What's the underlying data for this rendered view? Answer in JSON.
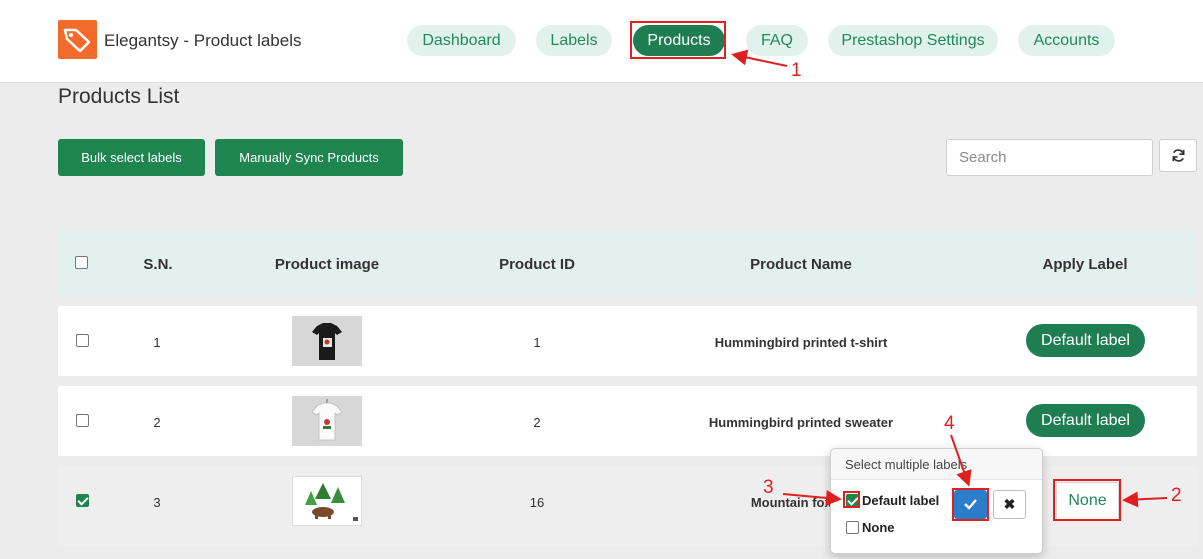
{
  "header": {
    "app_title": "Elegantsy - Product labels",
    "logo_icon": "price-tag-icon",
    "nav": [
      {
        "label": "Dashboard",
        "active": false
      },
      {
        "label": "Labels",
        "active": false
      },
      {
        "label": "Products",
        "active": true
      },
      {
        "label": "FAQ",
        "active": false
      },
      {
        "label": "Prestashop Settings",
        "active": false
      },
      {
        "label": "Accounts",
        "active": false
      }
    ]
  },
  "page": {
    "title": "Products List",
    "bulk_select_label": "Bulk select labels",
    "sync_label": "Manually Sync Products",
    "search_placeholder": "Search",
    "refresh_icon": "refresh-icon"
  },
  "table": {
    "columns": [
      "S.N.",
      "Product image",
      "Product ID",
      "Product Name",
      "Apply Label"
    ],
    "rows": [
      {
        "sn": "1",
        "product_id": "1",
        "name": "Hummingbird printed t-shirt",
        "label": "Default label",
        "checked": false,
        "image": "black-tshirt-image"
      },
      {
        "sn": "2",
        "product_id": "2",
        "name": "Hummingbird printed sweater",
        "label": "Default label",
        "checked": false,
        "image": "white-tshirt-image"
      },
      {
        "sn": "3",
        "product_id": "16",
        "name": "Mountain fox no",
        "label": "None",
        "checked": true,
        "image": "mountain-bear-image"
      }
    ]
  },
  "popover": {
    "title": "Select multiple labels",
    "options": [
      {
        "label": "Default label",
        "checked": true
      },
      {
        "label": "None",
        "checked": false
      }
    ],
    "confirm_icon": "checkmark-icon",
    "cancel_icon": "close-icon"
  },
  "annotations": [
    "1",
    "2",
    "3",
    "4"
  ],
  "colors": {
    "primary": "#1e7e52",
    "pill_bg": "#e1f2ec",
    "confirm_blue": "#2a7dc9",
    "annotation_red": "#e02020",
    "logo_orange": "#f26b2a"
  }
}
